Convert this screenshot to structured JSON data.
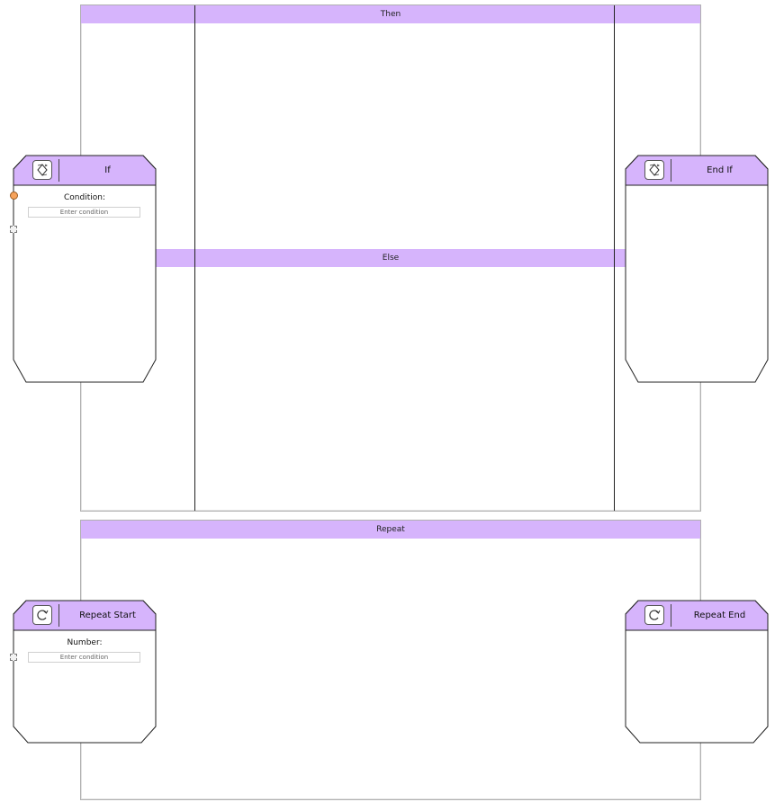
{
  "if_block": {
    "then_label": "Then",
    "else_label": "Else"
  },
  "repeat_block": {
    "label": "Repeat"
  },
  "nodes": {
    "if_node": {
      "title": "If",
      "icon": "diamond-branch-icon",
      "field_label": "Condition:",
      "field_placeholder": "Enter condition"
    },
    "end_if_node": {
      "title": "End If",
      "icon": "diamond-branch-icon"
    },
    "repeat_start_node": {
      "title": "Repeat Start",
      "icon": "loop-icon",
      "field_label": "Number:",
      "field_placeholder": "Enter condition"
    },
    "repeat_end_node": {
      "title": "Repeat End",
      "icon": "loop-icon"
    }
  },
  "colors": {
    "header": "#d6b4fc",
    "port_active": "#f7a35c"
  }
}
